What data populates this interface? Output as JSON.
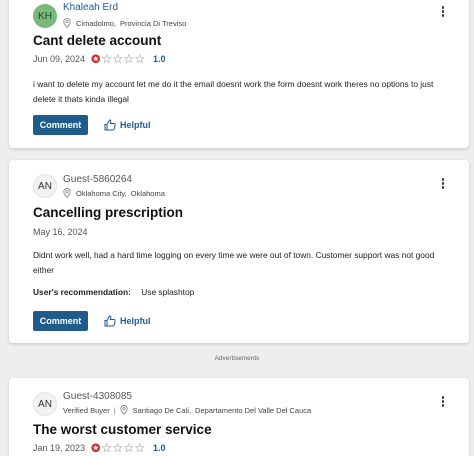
{
  "reviews": [
    {
      "avatar_initials": "KH",
      "avatar_color": "#7ab97c",
      "reviewer_name": "Khaleah Erd",
      "location_city": "Cimadolmo,",
      "location_region": "Provincia Di Treviso",
      "title": "Cant delete account",
      "date": "Jun 09, 2024",
      "rating": "1.0",
      "stars_filled": 1,
      "body": "i want to delete my account let me do it the email doesnt work the form doesnt work theres no options to just delete it thats kinda illegal",
      "comment_label": "Comment",
      "helpful_label": "Helpful"
    },
    {
      "avatar_initials": "AN",
      "reviewer_name": "Guest-5860264",
      "location_city": "Oklahoma City,",
      "location_region": "Oklahoma",
      "title": "Cancelling prescription",
      "date": "May 16, 2024",
      "body": "Didnt work well, had a hard time logging on every time we were out of town. Customer support was not good either",
      "recommendation_label": "User's recommendation:",
      "recommendation_value": "Use splashtop",
      "comment_label": "Comment",
      "helpful_label": "Helpful"
    },
    {
      "avatar_initials": "AN",
      "reviewer_name": "Guest-4308085",
      "verified_label": "Verified Buyer",
      "separator": "|",
      "location_city": "Santiago De Cali,",
      "location_region": "Departamento Del Valle Del Cauca",
      "title": "The worst customer service",
      "date": "Jan 19, 2023",
      "rating": "1.0",
      "stars_filled": 1
    }
  ],
  "ads_label": "Advertisements",
  "colors": {
    "accent": "#1f5c8c",
    "link": "#1d5a95",
    "star_filled": "#d32f2f",
    "star_empty": "#bdbdbd"
  },
  "icons": {
    "pin": "location-pin-icon",
    "thumb": "thumbs-up-icon",
    "kebab": "more-options-icon",
    "star": "star-icon"
  }
}
